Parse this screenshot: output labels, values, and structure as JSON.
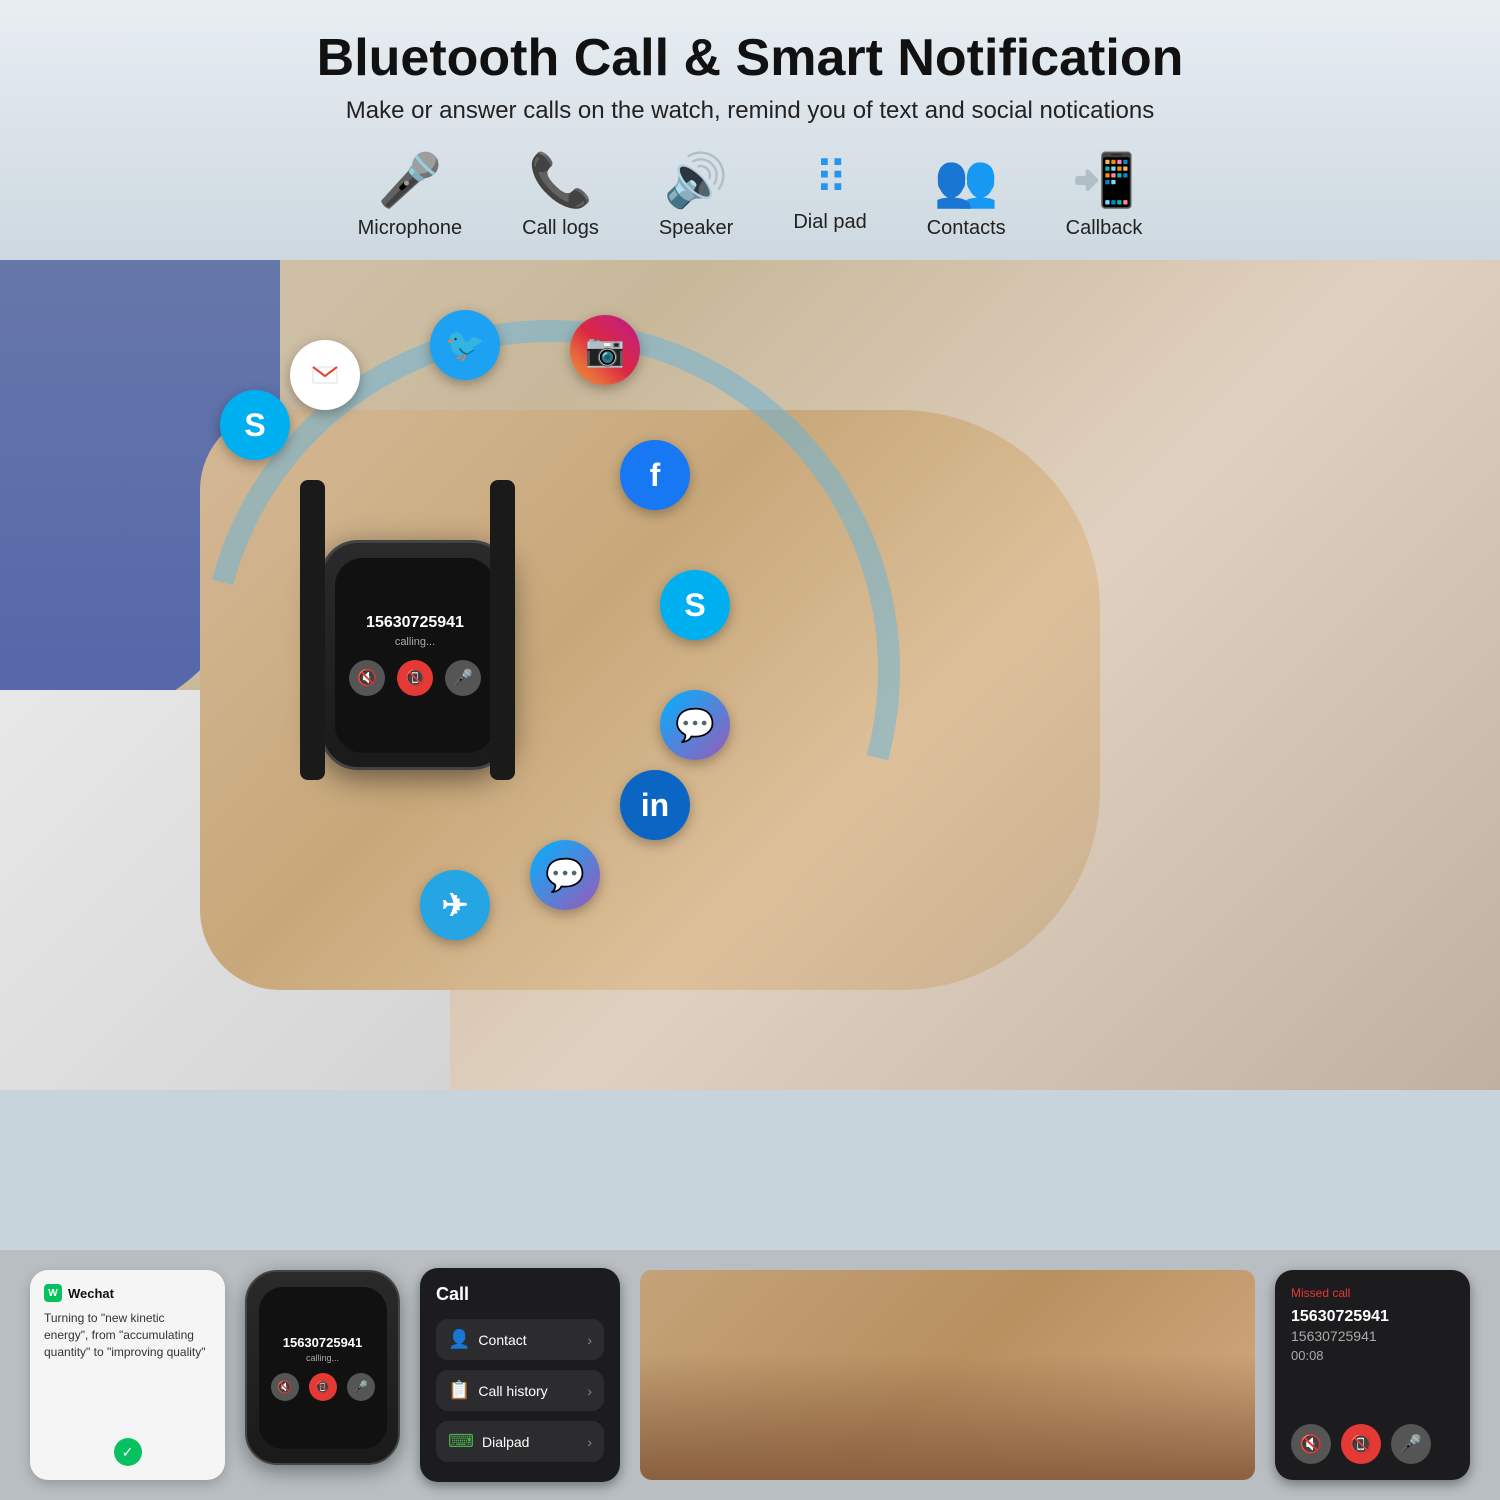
{
  "header": {
    "title": "Bluetooth Call & Smart Notification",
    "subtitle": "Make or answer calls on the watch, remind you of text and social notications"
  },
  "features": [
    {
      "id": "microphone",
      "label": "Microphone",
      "icon": "🎤"
    },
    {
      "id": "call-logs",
      "label": "Call logs",
      "icon": "📞"
    },
    {
      "id": "speaker",
      "label": "Speaker",
      "icon": "🔊"
    },
    {
      "id": "dial-pad",
      "label": "Dial pad",
      "icon": "⠿"
    },
    {
      "id": "contacts",
      "label": "Contacts",
      "icon": "👥"
    },
    {
      "id": "callback",
      "label": "Callback",
      "icon": "📲"
    }
  ],
  "watch_main": {
    "number": "15630725941",
    "status": "calling..."
  },
  "watch_small": {
    "number": "15630725941",
    "status": "calling..."
  },
  "wechat": {
    "app_name": "Wechat",
    "message": "Turning to \"new kinetic energy\", from \"accumulating quantity\" to \"improving quality\""
  },
  "call_menu": {
    "title": "Call",
    "items": [
      {
        "label": "Contact",
        "icon": "👤"
      },
      {
        "label": "Call history",
        "icon": "📋"
      },
      {
        "label": "Dialpad",
        "icon": "⠿"
      }
    ]
  },
  "missed_call": {
    "header": "Missed call",
    "number1": "15630725941",
    "number2": "15630725941",
    "time": "00:08"
  },
  "social_icons": [
    {
      "id": "gmail",
      "label": "Gmail"
    },
    {
      "id": "twitter",
      "label": "Twitter"
    },
    {
      "id": "instagram",
      "label": "Instagram"
    },
    {
      "id": "skype-top",
      "label": "Skype"
    },
    {
      "id": "facebook",
      "label": "Facebook"
    },
    {
      "id": "skype-mid",
      "label": "Skype"
    },
    {
      "id": "messenger",
      "label": "Messenger"
    },
    {
      "id": "linkedin",
      "label": "LinkedIn"
    },
    {
      "id": "messenger2",
      "label": "Messenger"
    },
    {
      "id": "telegram",
      "label": "Telegram"
    }
  ]
}
